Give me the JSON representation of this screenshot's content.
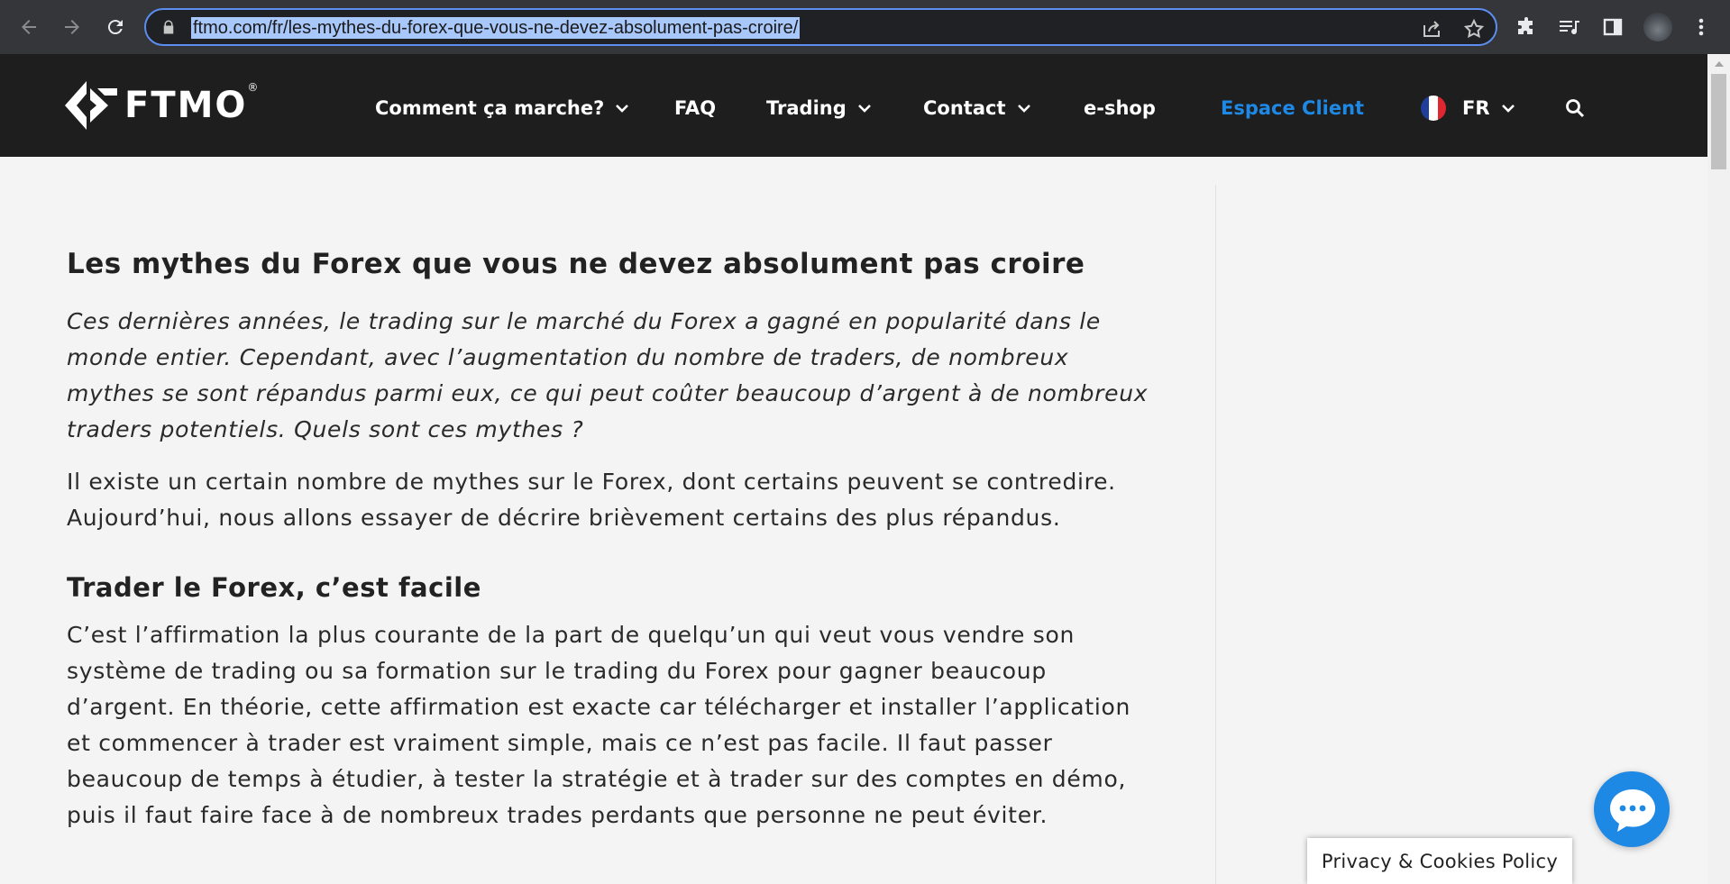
{
  "browser": {
    "url": "ftmo.com/fr/les-mythes-du-forex-que-vous-ne-devez-absolument-pas-croire/"
  },
  "header": {
    "logo_text": "FTMO",
    "logo_reg": "®",
    "menu": [
      {
        "label": "Comment ça marche?",
        "has_dropdown": true
      },
      {
        "label": "FAQ",
        "has_dropdown": false
      },
      {
        "label": "Trading",
        "has_dropdown": true
      },
      {
        "label": "Contact",
        "has_dropdown": true
      },
      {
        "label": "e-shop",
        "has_dropdown": false
      },
      {
        "label": "Espace Client",
        "has_dropdown": false
      }
    ],
    "language": "FR"
  },
  "colors": {
    "accent": "#1e88e5",
    "header_bg": "#1e1e1e",
    "page_bg": "#f4f4f4"
  },
  "article": {
    "title": "Les mythes du Forex que vous ne devez absolument pas croire",
    "lead": "Ces dernières années, le trading sur le marché du Forex a gagné en popularité dans le monde entier. Cependant, avec l’augmentation du nombre de traders, de nombreux mythes se sont répandus parmi eux, ce qui peut coûter beaucoup d’argent à de nombreux traders potentiels. Quels sont ces mythes ?",
    "intro": "Il existe un certain nombre de mythes sur le Forex, dont certains peuvent se contredire. Aujourd’hui, nous allons essayer de décrire brièvement certains des plus répandus.",
    "section1_title": "Trader le Forex, c’est facile",
    "section1_body": "C’est l’affirmation la plus courante de la part de quelqu’un qui veut vous vendre son système de trading ou sa formation sur le trading du Forex pour gagner beaucoup d’argent. En théorie, cette affirmation est exacte car télécharger et installer l’application et commencer à trader est vraiment simple, mais ce n’est pas facile. Il faut passer beaucoup de temps à étudier, à tester la stratégie et à trader sur des comptes en démo, puis il faut faire face à de nombreux trades perdants que personne ne peut éviter."
  },
  "privacy_label": "Privacy & Cookies Policy"
}
